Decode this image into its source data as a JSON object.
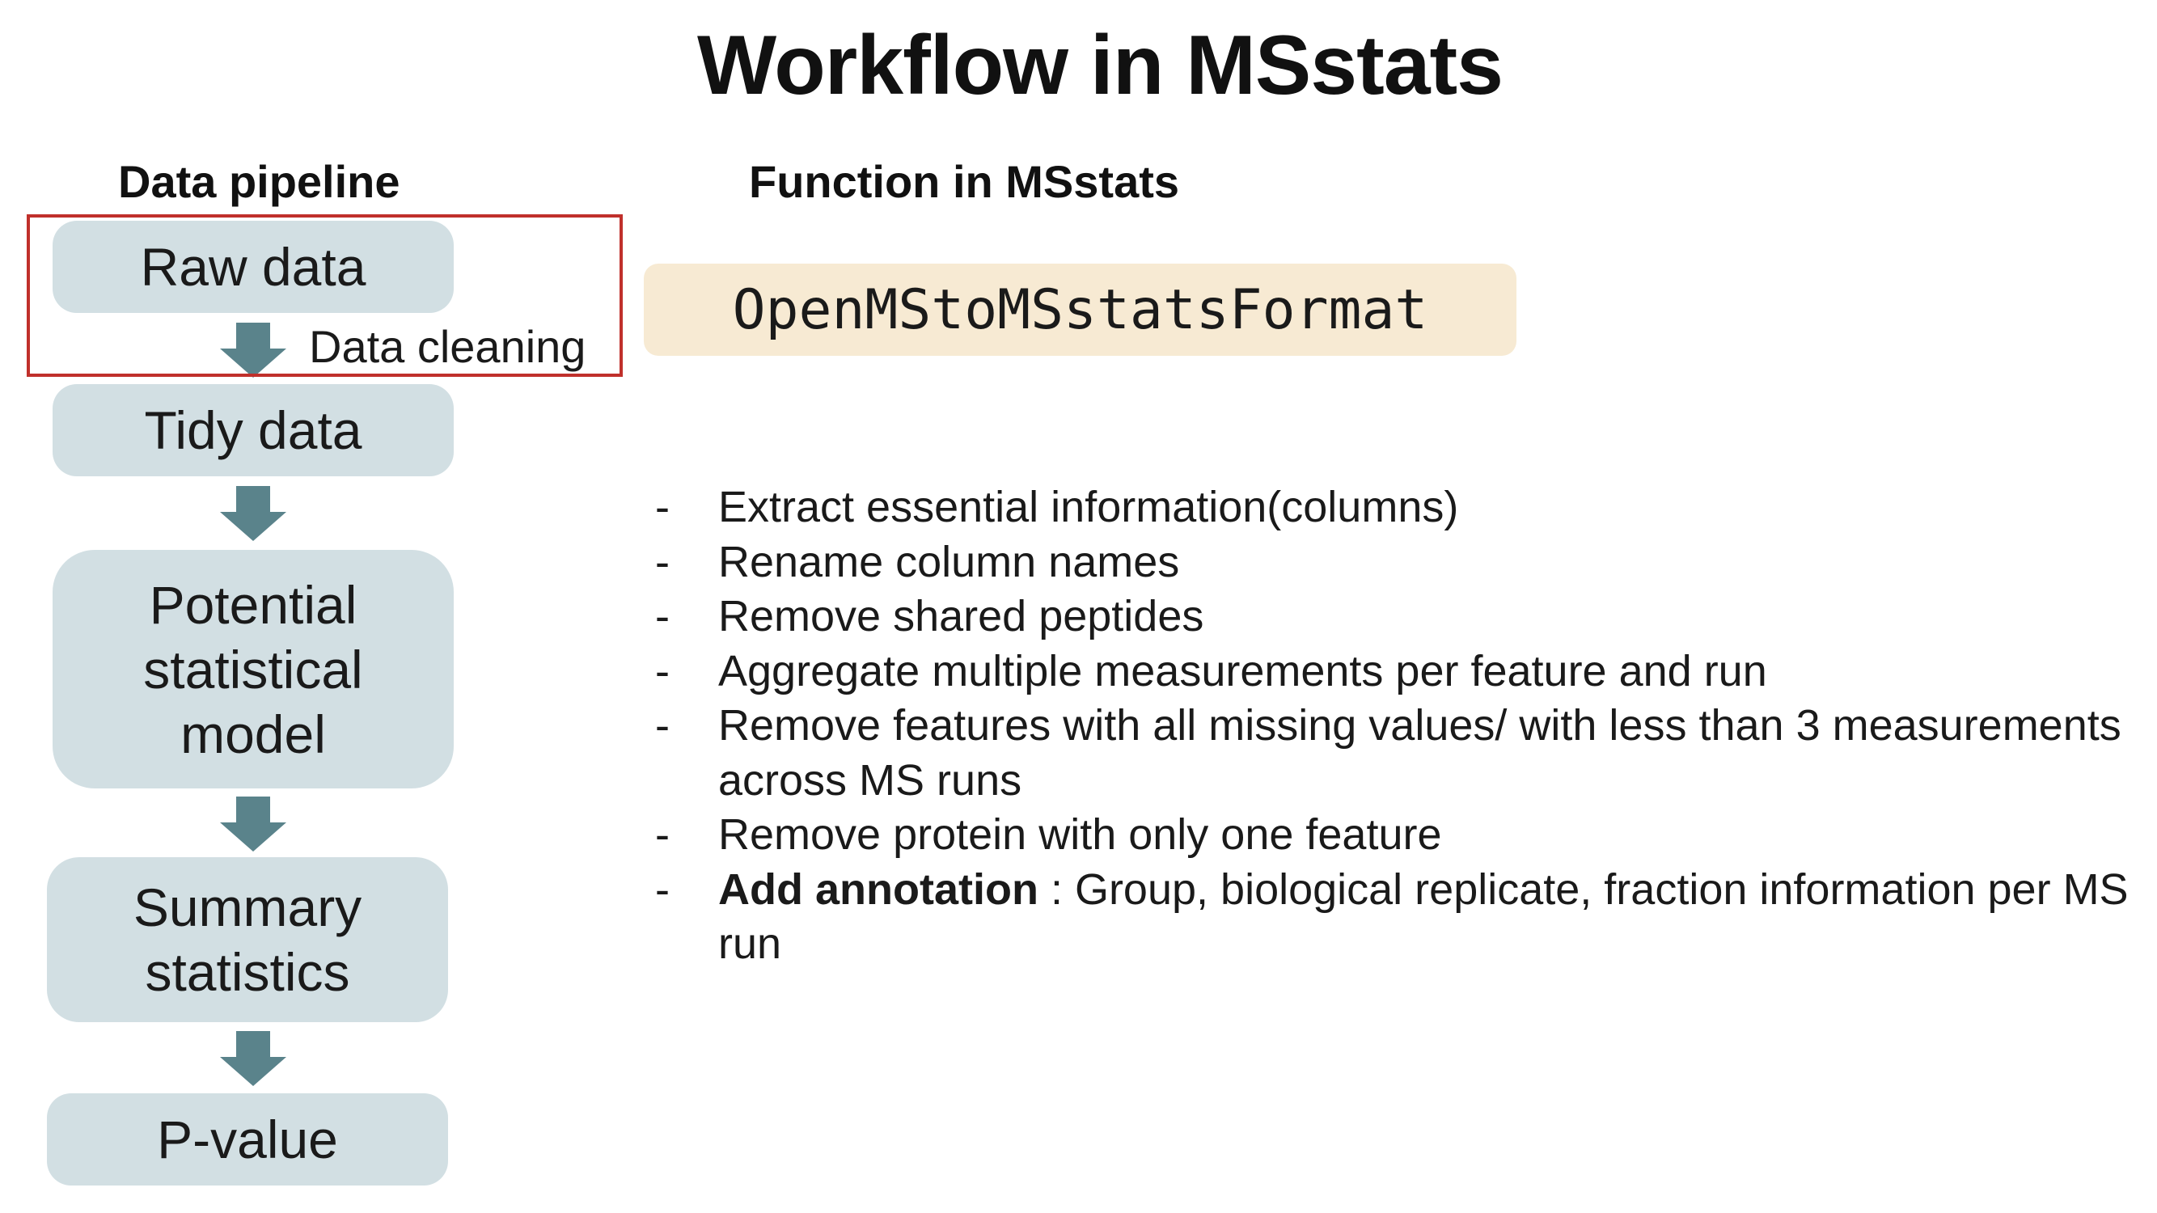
{
  "title": "Workflow in MSstats",
  "headers": {
    "pipeline": "Data pipeline",
    "function": "Function in MSstats"
  },
  "pipeline": {
    "raw": [
      "Raw data"
    ],
    "tidy": [
      "Tidy data"
    ],
    "model": [
      "Potential",
      "statistical",
      "model"
    ],
    "summary": [
      "Summary",
      "statistics"
    ],
    "pvalue": [
      "P-value"
    ],
    "cleaning_label": "Data cleaning"
  },
  "function_name": "OpenMStoMSstatsFormat",
  "bullet_marker": "-",
  "bullets": [
    {
      "bold": "",
      "text": "Extract essential information(columns)"
    },
    {
      "bold": "",
      "text": "Rename column names"
    },
    {
      "bold": "",
      "text": "Remove shared peptides"
    },
    {
      "bold": "",
      "text": "Aggregate multiple measurements per feature and run"
    },
    {
      "bold": "",
      "text": "Remove features with all missing values/ with less than 3 measurements across MS runs"
    },
    {
      "bold": "",
      "text": "Remove protein with only one feature"
    },
    {
      "bold": "Add annotation",
      "text": " : Group, biological replicate, fraction information per MS run"
    }
  ],
  "colors": {
    "pipeline_box": "#d2dfe3",
    "arrow": "#5a838b",
    "highlight_border": "#c0302b",
    "function_box": "#f7ead3"
  }
}
